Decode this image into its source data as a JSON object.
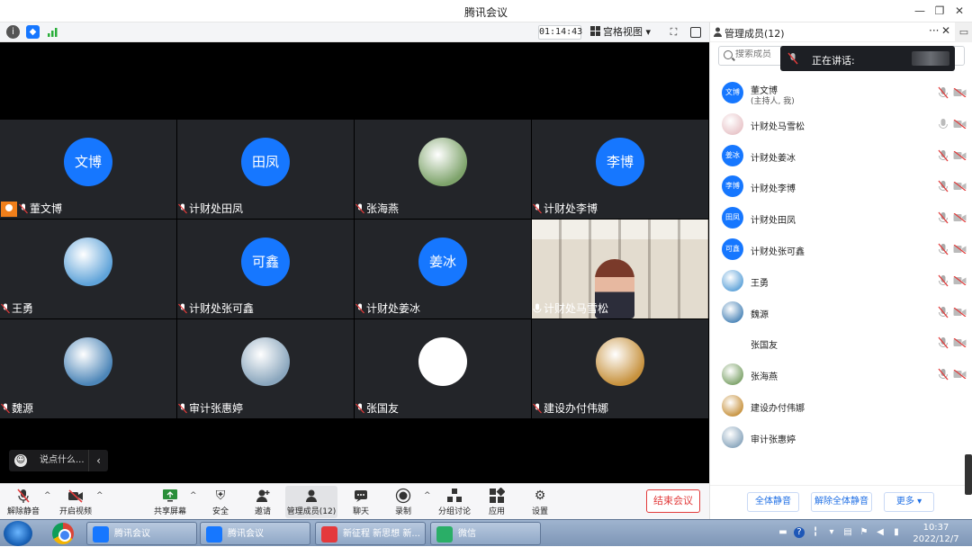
{
  "window": {
    "title": "腾讯会议"
  },
  "toolbar": {
    "timer": "01:14:43",
    "view_mode": "宫格视图"
  },
  "tiles": [
    {
      "name": "董文博",
      "avatar_text": "文博",
      "host": true,
      "photo": false
    },
    {
      "name": "计财处田凤",
      "avatar_text": "田凤",
      "host": false,
      "photo": false
    },
    {
      "name": "张海燕",
      "avatar_text": "",
      "host": false,
      "photo": true,
      "photo_color": "#7ea36b"
    },
    {
      "name": "计财处李博",
      "avatar_text": "李博",
      "host": false,
      "photo": false
    },
    {
      "name": "王勇",
      "avatar_text": "",
      "host": false,
      "photo": true,
      "photo_color": "#5fa3d9"
    },
    {
      "name": "计财处张可鑫",
      "avatar_text": "可鑫",
      "host": false,
      "photo": false
    },
    {
      "name": "计财处姜冰",
      "avatar_text": "姜冰",
      "host": false,
      "photo": false
    },
    {
      "name": "计财处马雪松",
      "avatar_text": "",
      "host": false,
      "photo": false,
      "video": true
    },
    {
      "name": "魏源",
      "avatar_text": "",
      "host": false,
      "photo": true,
      "photo_color": "#4d86b8"
    },
    {
      "name": "审计张惠婷",
      "avatar_text": "",
      "host": false,
      "photo": true,
      "photo_color": "#8aa6bd"
    },
    {
      "name": "张国友",
      "avatar_text": "",
      "host": false,
      "photo": true,
      "photo_color": "#ffffff"
    },
    {
      "name": "建设办付伟娜",
      "avatar_text": "",
      "host": false,
      "photo": true,
      "photo_color": "#c7923e"
    }
  ],
  "chat": {
    "placeholder": "说点什么..."
  },
  "bottombar": {
    "unmute": "解除静音",
    "video": "开启视频",
    "share": "共享屏幕",
    "security": "安全",
    "invite": "邀请",
    "members": "管理成员(12)",
    "chat": "聊天",
    "record": "录制",
    "breakout": "分组讨论",
    "apps": "应用",
    "settings": "设置",
    "end": "结束会议"
  },
  "panel": {
    "title": "管理成员(12)",
    "search_placeholder": "搜索成员",
    "speaking_label": "正在讲话:",
    "members": [
      {
        "name": "董文博",
        "sub": "(主持人, 我)",
        "avatar_text": "文博",
        "photo": false
      },
      {
        "name": "计财处马雪松",
        "sub": "",
        "avatar_text": "",
        "photo": true,
        "photo_color": "#e8c5c9"
      },
      {
        "name": "计财处姜冰",
        "sub": "",
        "avatar_text": "姜冰",
        "photo": false
      },
      {
        "name": "计财处李博",
        "sub": "",
        "avatar_text": "李博",
        "photo": false
      },
      {
        "name": "计财处田凤",
        "sub": "",
        "avatar_text": "田凤",
        "photo": false
      },
      {
        "name": "计财处张可鑫",
        "sub": "",
        "avatar_text": "可鑫",
        "photo": false
      },
      {
        "name": "王勇",
        "sub": "",
        "avatar_text": "",
        "photo": true,
        "photo_color": "#5fa3d9"
      },
      {
        "name": "魏源",
        "sub": "",
        "avatar_text": "",
        "photo": true,
        "photo_color": "#4d86b8"
      },
      {
        "name": "张国友",
        "sub": "",
        "avatar_text": "",
        "photo": true,
        "photo_color": "#ffffff"
      },
      {
        "name": "张海燕",
        "sub": "",
        "avatar_text": "",
        "photo": true,
        "photo_color": "#7ea36b"
      },
      {
        "name": "建设办付伟娜",
        "sub": "",
        "avatar_text": "",
        "photo": true,
        "photo_color": "#c7923e"
      },
      {
        "name": "审计张惠婷",
        "sub": "",
        "avatar_text": "",
        "photo": true,
        "photo_color": "#8aa6bd"
      }
    ],
    "mute_all": "全体静音",
    "unmute_all": "解除全体静音",
    "more": "更多"
  },
  "taskbar": {
    "tasks": [
      {
        "label": "腾讯会议",
        "color": "#1677ff"
      },
      {
        "label": "腾讯会议",
        "color": "#1677ff"
      },
      {
        "label": "新征程 新思想 新...",
        "color": "#e4393c"
      },
      {
        "label": "微信",
        "color": "#2aae67"
      }
    ],
    "time": "10:37",
    "date": "2022/12/7"
  },
  "colors": {
    "accent": "#1677ff",
    "danger": "#e23b3b",
    "host_badge": "#f07f1a"
  }
}
